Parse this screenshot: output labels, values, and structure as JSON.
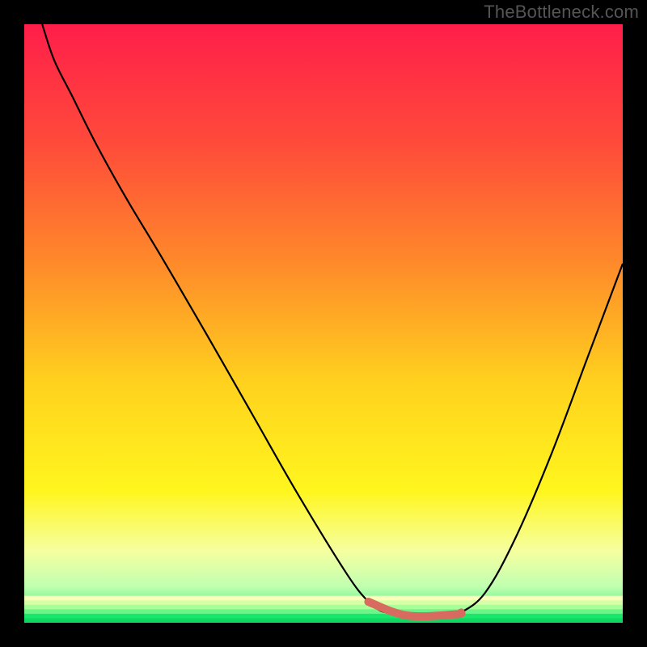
{
  "watermark": "TheBottleneck.com",
  "chart_data": {
    "type": "line",
    "title": "",
    "xlabel": "",
    "ylabel": "",
    "xlim": [
      0,
      100
    ],
    "ylim": [
      0,
      100
    ],
    "grid": false,
    "legend": false,
    "background_gradient": {
      "stops": [
        {
          "offset": 0.0,
          "color": "#ff1e4a"
        },
        {
          "offset": 0.2,
          "color": "#ff4b3a"
        },
        {
          "offset": 0.4,
          "color": "#ff8a2a"
        },
        {
          "offset": 0.6,
          "color": "#ffd21e"
        },
        {
          "offset": 0.78,
          "color": "#fff61e"
        },
        {
          "offset": 0.88,
          "color": "#f6ffa0"
        },
        {
          "offset": 0.94,
          "color": "#c0ffb0"
        },
        {
          "offset": 1.0,
          "color": "#17e86b"
        }
      ]
    },
    "series": [
      {
        "name": "curve",
        "color": "#000000",
        "stroke_width": 2.2,
        "x": [
          3,
          5,
          8,
          12,
          17,
          23,
          30,
          38,
          46,
          54,
          57.5,
          59,
          60.5,
          64,
          68,
          72,
          73,
          77,
          82,
          88,
          94,
          100
        ],
        "y": [
          100,
          94,
          88,
          80,
          71,
          61,
          49,
          35,
          21,
          8,
          3.5,
          2.3,
          1.7,
          1.2,
          1.2,
          1.4,
          1.7,
          5,
          14,
          28,
          44,
          60
        ]
      },
      {
        "name": "bottom-stripes",
        "note": "thin horizontal green/yellow bands along the very bottom of the plot",
        "y_fraction_range": [
          0.955,
          1.0
        ]
      },
      {
        "name": "highlight-segment",
        "note": "short salmon stroke near the valley minimum with a dot at its left end",
        "color": "#d86a60",
        "stroke_width": 10,
        "linecap": "round",
        "x": [
          57.5,
          64,
          72,
          73
        ],
        "y": [
          3.5,
          1.2,
          1.4,
          1.7
        ],
        "marker": {
          "x": 57.5,
          "y": 3.5,
          "r": 5
        }
      }
    ]
  }
}
